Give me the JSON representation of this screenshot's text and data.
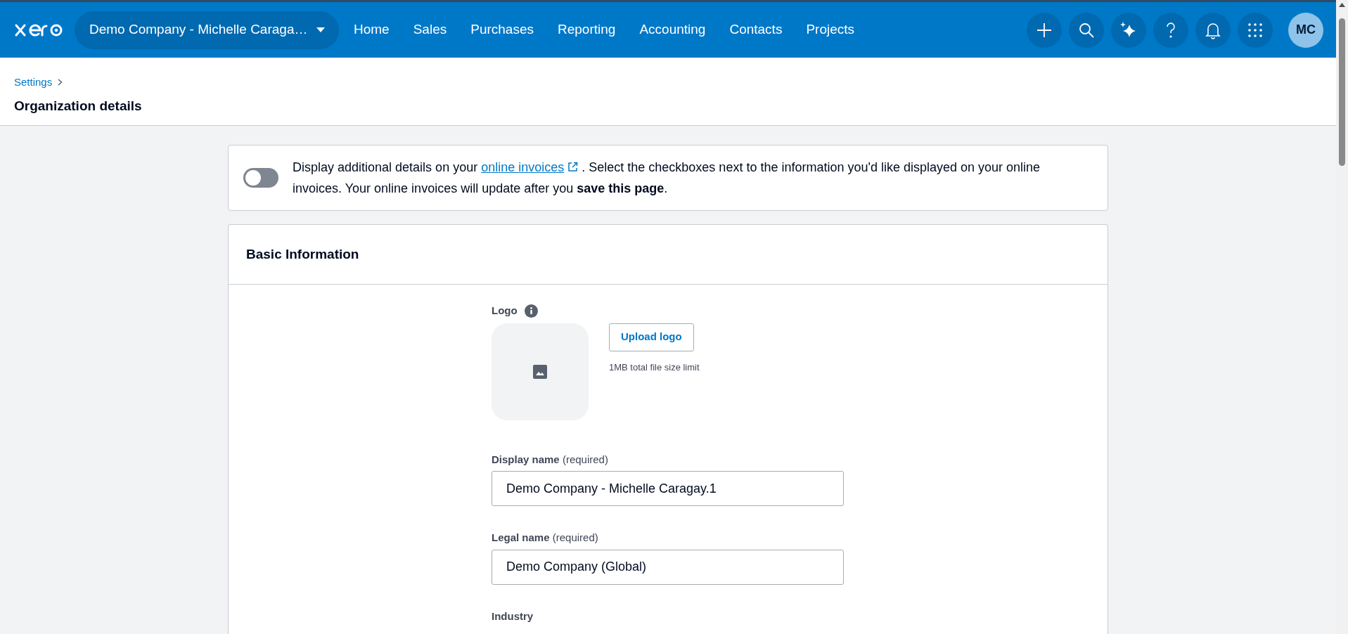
{
  "header": {
    "org_switcher": "Demo Company - Michelle Caraga…",
    "nav": [
      {
        "label": "Home"
      },
      {
        "label": "Sales"
      },
      {
        "label": "Purchases"
      },
      {
        "label": "Reporting"
      },
      {
        "label": "Accounting"
      },
      {
        "label": "Contacts"
      },
      {
        "label": "Projects"
      }
    ],
    "avatar": "MC"
  },
  "breadcrumb": "Settings",
  "page_title": "Organization details",
  "banner": {
    "toggle_on": false,
    "text_before": "Display additional details on your",
    "link": "online invoices",
    "text_after": ". Select the checkboxes next to the information you'd like displayed on your online invoices. Your online invoices will update after you **save this page**."
  },
  "card": {
    "title": "Basic Information",
    "logo": {
      "label": "Logo",
      "button": "Upload logo",
      "hint": "1MB total file size limit"
    },
    "fields": [
      {
        "label": "Display name",
        "note": "(required)",
        "value": "Demo Company - Michelle Caragay.1"
      },
      {
        "label": "Legal name",
        "note": "(required)",
        "value": "Demo Company (Global)"
      }
    ],
    "next_label": "Industry"
  }
}
